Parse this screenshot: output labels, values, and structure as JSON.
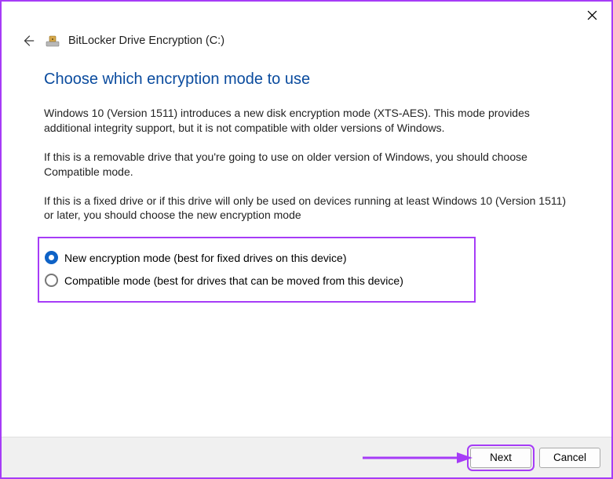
{
  "window": {
    "title": "BitLocker Drive Encryption (C:)"
  },
  "page": {
    "heading": "Choose which encryption mode to use",
    "paragraph1": "Windows 10 (Version 1511) introduces a new disk encryption mode (XTS-AES). This mode provides additional integrity support, but it is not compatible with older versions of Windows.",
    "paragraph2": "If this is a removable drive that you're going to use on older version of Windows, you should choose Compatible mode.",
    "paragraph3": "If this is a fixed drive or if this drive will only be used on devices running at least Windows 10 (Version 1511) or later, you should choose the new encryption mode"
  },
  "options": [
    {
      "label": "New encryption mode (best for fixed drives on this device)",
      "selected": true
    },
    {
      "label": "Compatible mode (best for drives that can be moved from this device)",
      "selected": false
    }
  ],
  "buttons": {
    "next": "Next",
    "cancel": "Cancel"
  }
}
